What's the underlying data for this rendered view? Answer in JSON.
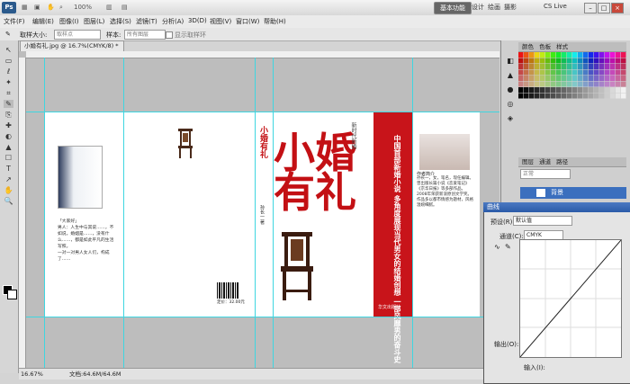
{
  "app": {
    "logo": "Ps",
    "zoom_select": "100%",
    "workspace": "基本功能",
    "ws_tabs": [
      "设计",
      "绘画",
      "摄影"
    ],
    "cs_live": "CS Live",
    "win_controls": [
      "–",
      "□",
      "×"
    ]
  },
  "menu": [
    "文件(F)",
    "编辑(E)",
    "图像(I)",
    "图层(L)",
    "选择(S)",
    "滤镜(T)",
    "分析(A)",
    "3D(D)",
    "视图(V)",
    "窗口(W)",
    "帮助(H)"
  ],
  "options": {
    "sample_size_label": "取样大小:",
    "sample_size_value": "取样点",
    "sample_label": "样本:",
    "sample_value": "所有图层",
    "ring_label": "显示取样环"
  },
  "document": {
    "tab": "小婚有礼.jpg @ 16.7%(CMYK/8) *",
    "zoom": "16.67%",
    "doc_info": "文档:64.6M/64.6M"
  },
  "cover": {
    "title": "小婚有礼",
    "series": "新时代新婚",
    "spine_title": "小婚有礼",
    "spine_author": "孙长一 著",
    "red_band": "中国首部新婚小说 多角度展现当代男女的结婚创想 一部风靡男的奋斗史",
    "publisher": "华文出版社",
    "author_heading": "作者简介",
    "author_text": "孙长一，女，笔名，现任编辑。曾出版长篇小说《恋爱笔记》《京华日报》等多部作品。2008年荣获新浪原创文学奖。作品多以都市情感为题材，风格温婉细腻。",
    "back_para": "「大家好」\n男人：人生中与其说……，不如说，婚姻是……，没有什么……，都是如此平凡的生活写照。\n一对一对男人女人们，构成了……",
    "back_price": "定价：32.00元"
  },
  "panels": {
    "color_tabs": [
      "颜色",
      "色板",
      "样式"
    ],
    "layer_tabs": [
      "图层",
      "通道",
      "路径"
    ],
    "blend": "正常",
    "layer_name": "背景"
  },
  "curves": {
    "title": "曲线",
    "preset_label": "预设(R):",
    "preset_value": "默认值",
    "channel_label": "通道(C):",
    "channel_value": "CMYK",
    "output_label": "输出(O):",
    "input_label": "输入(I):"
  },
  "tools": [
    "↖",
    "▭",
    "ℓ",
    "✦",
    "⌗",
    "✎",
    "⎘",
    "✚",
    "◐",
    "▲",
    "☐",
    "T",
    "↗",
    "✋",
    "🔍"
  ]
}
